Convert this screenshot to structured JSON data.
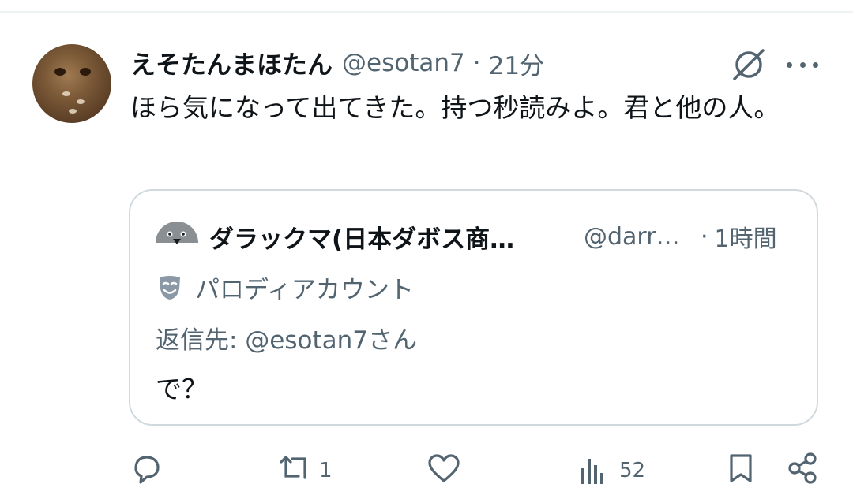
{
  "tweet": {
    "display_name": "えそたんまほたん",
    "handle": "@esotan7",
    "separator": "·",
    "time": "21分",
    "text": "ほら気になって出てきた。持つ秒読みよ。君と他の人。",
    "avatar_icon": "frog-photo-avatar",
    "grok_icon": "grok-icon",
    "more_icon": "more-options-icon"
  },
  "quote": {
    "display_name": "ダラックマ(日本ダボス商…",
    "handle": "@darr…",
    "separator": "·",
    "time": "1時間",
    "parody_label": "パロディアカウント",
    "reply_to": "返信先: @esotan7さん",
    "text": "で？"
  },
  "actions": {
    "reply_count": "",
    "retweet_count": "1",
    "like_count": "",
    "views_count": "52"
  },
  "colors": {
    "text_primary": "#0f1419",
    "text_secondary": "#536471",
    "border": "#cfd9de"
  }
}
